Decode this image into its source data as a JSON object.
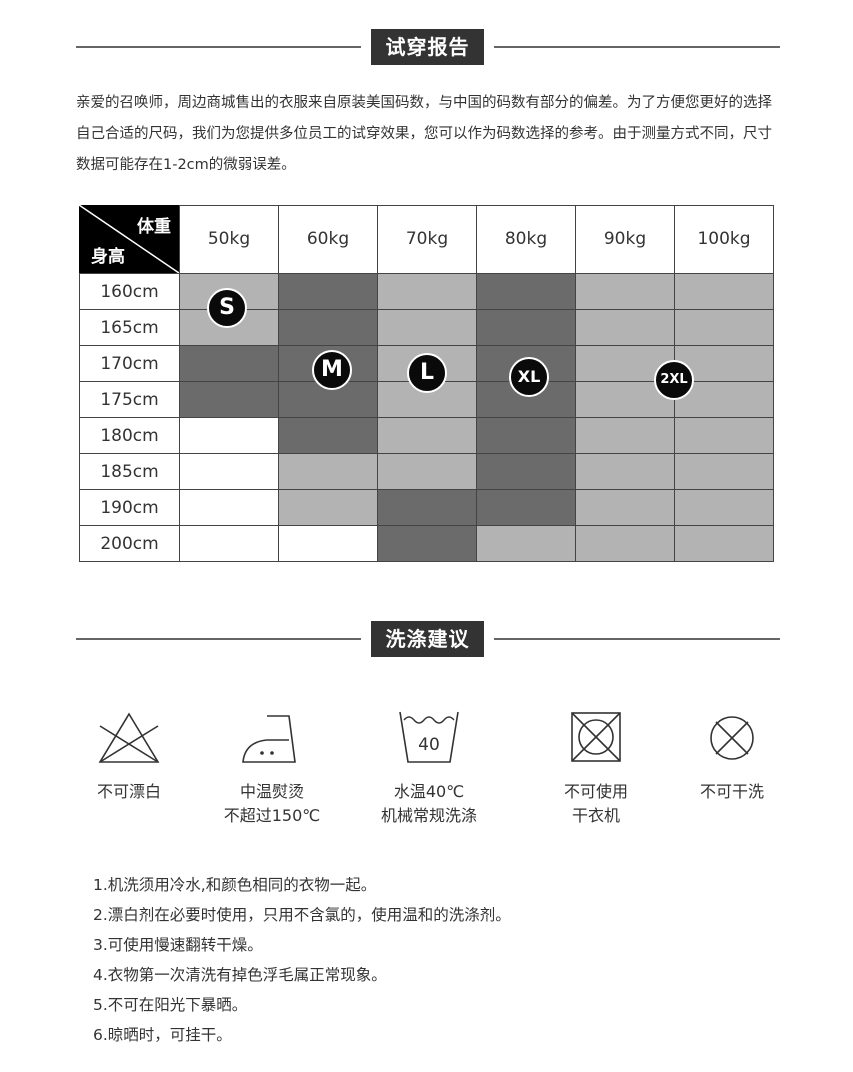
{
  "fit_section": {
    "title": "试穿报告"
  },
  "intro_text": "亲爱的召唤师，周边商城售出的衣服来自原装美国码数，与中国的码数有部分的偏差。为了方便您更好的选择自己合适的尺码，我们为您提供多位员工的试穿效果，您可以作为码数选择的参考。由于测量方式不同，尺寸数据可能存在1-2cm的微弱误差。",
  "size_table": {
    "corner_weight": "体重",
    "corner_height": "身高",
    "weights": [
      "50kg",
      "60kg",
      "70kg",
      "80kg",
      "90kg",
      "100kg"
    ],
    "heights": [
      "160cm",
      "165cm",
      "170cm",
      "175cm",
      "180cm",
      "185cm",
      "190cm",
      "200cm"
    ],
    "shade_grid": [
      [
        "light",
        "dark",
        "light",
        "dark",
        "light",
        "light"
      ],
      [
        "light",
        "dark",
        "light",
        "dark",
        "light",
        "light"
      ],
      [
        "dark",
        "dark",
        "light",
        "dark",
        "light",
        "light"
      ],
      [
        "dark",
        "dark",
        "light",
        "dark",
        "light",
        "light"
      ],
      [
        "white",
        "dark",
        "light",
        "dark",
        "light",
        "light"
      ],
      [
        "white",
        "light",
        "light",
        "dark",
        "light",
        "light"
      ],
      [
        "white",
        "light",
        "dark",
        "dark",
        "light",
        "light"
      ],
      [
        "white",
        "white",
        "dark",
        "light",
        "light",
        "light"
      ]
    ],
    "shade_colors": {
      "dark": "#6b6b6b",
      "light": "#b3b3b3",
      "white": "#ffffff"
    },
    "size_badges": [
      "S",
      "M",
      "L",
      "XL",
      "2XL"
    ]
  },
  "wash_section": {
    "title": "洗涤建议"
  },
  "wash_icons": [
    {
      "icon": "no-bleach-icon",
      "caption_lines": [
        "不可漂白"
      ]
    },
    {
      "icon": "iron-medium-icon",
      "caption_lines": [
        "中温熨烫",
        "不超过150℃"
      ]
    },
    {
      "icon": "machine-wash-40-icon",
      "temp_label": "40",
      "caption_lines": [
        "水温40℃",
        "机械常规洗涤"
      ]
    },
    {
      "icon": "no-tumble-dry-icon",
      "caption_lines": [
        "不可使用",
        "干衣机"
      ]
    },
    {
      "icon": "no-dry-clean-icon",
      "caption_lines": [
        "不可干洗"
      ]
    }
  ],
  "care_notes": [
    "1.机洗须用冷水,和颜色相同的衣物一起。",
    "2.漂白剂在必要时使用，只用不含氯的，使用温和的洗涤剂。",
    "3.可使用慢速翻转干燥。",
    "4.衣物第一次清洗有掉色浮毛属正常现象。",
    "5.不可在阳光下暴晒。",
    "6.晾晒时，可挂干。"
  ]
}
